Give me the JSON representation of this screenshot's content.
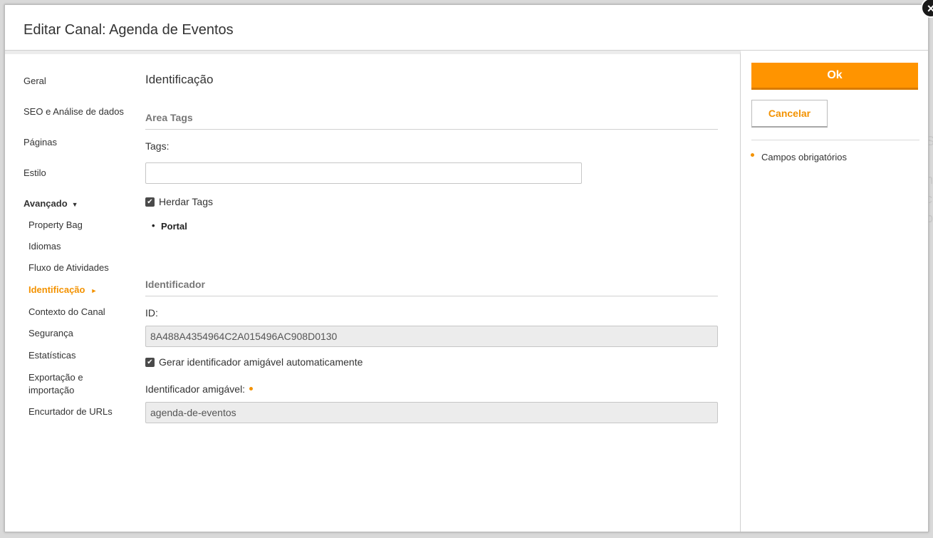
{
  "dialog": {
    "title": "Editar Canal: Agenda de Eventos",
    "close_label": "×"
  },
  "nav": {
    "items": [
      {
        "label": "Geral"
      },
      {
        "label": "SEO e Análise de dados"
      },
      {
        "label": "Páginas"
      },
      {
        "label": "Estilo"
      },
      {
        "label": "Avançado"
      }
    ],
    "advanced_caret": "▼",
    "sub_items": [
      {
        "label": "Property Bag"
      },
      {
        "label": "Idiomas"
      },
      {
        "label": "Fluxo de Atividades"
      },
      {
        "label": "Identificação"
      },
      {
        "label": "Contexto do Canal"
      },
      {
        "label": "Segurança"
      },
      {
        "label": "Estatísticas"
      },
      {
        "label": "Exportação e importação"
      },
      {
        "label": "Encurtador de URLs"
      }
    ],
    "active_arrow": "►"
  },
  "main": {
    "section_title": "Identificação",
    "area_tags": {
      "heading": "Area Tags",
      "tags_label": "Tags:",
      "tags_value": "",
      "inherit_checked": true,
      "inherit_label": "Herdar Tags",
      "inherited": [
        "Portal"
      ]
    },
    "identifier": {
      "heading": "Identificador",
      "id_label": "ID:",
      "id_value": "8A488A4354964C2A015496AC908D0130",
      "auto_checked": true,
      "auto_label": "Gerar identificador amigável automaticamente",
      "friendly_label": "Identificador amigável:",
      "friendly_value": "agenda-de-eventos"
    }
  },
  "actions": {
    "ok_label": "Ok",
    "cancel_label": "Cancelar",
    "required_note": "Campos obrigatórios"
  },
  "check_glyph": "✔",
  "colors": {
    "accent": "#f39200",
    "ok_button": "#ff9400"
  }
}
